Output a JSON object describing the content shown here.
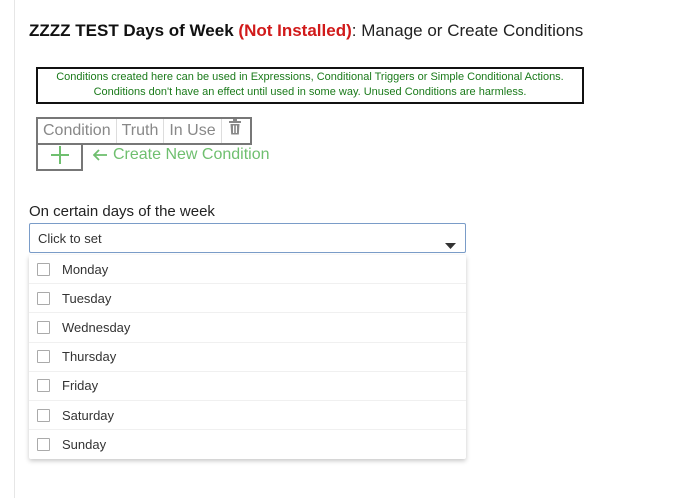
{
  "header": {
    "app_name": "ZZZZ TEST Days of Week",
    "status": "(Not Installed)",
    "subtitle": ": Manage or Create Conditions"
  },
  "info": {
    "line1": "Conditions created here can be used in Expressions, Conditional Triggers or Simple Conditional Actions.",
    "line2": "Conditions don't have an effect until used in some way.  Unused Conditions are harmless."
  },
  "conditions_table": {
    "columns": [
      "Condition",
      "Truth",
      "In Use"
    ],
    "delete_icon": "trash-icon"
  },
  "create": {
    "add_icon": "plus-icon",
    "label": "Create New Condition",
    "arrow_icon": "left-arrow-icon"
  },
  "days_field": {
    "label": "On certain days of the week",
    "placeholder": "Click to set",
    "caret_icon": "caret-down-icon",
    "options": [
      "Monday",
      "Tuesday",
      "Wednesday",
      "Thursday",
      "Friday",
      "Saturday",
      "Sunday"
    ]
  },
  "colors": {
    "status_red": "#d11a1a",
    "info_green": "#1a7a1a",
    "create_green": "#6fbf6f",
    "select_border": "#7a9cc8"
  }
}
